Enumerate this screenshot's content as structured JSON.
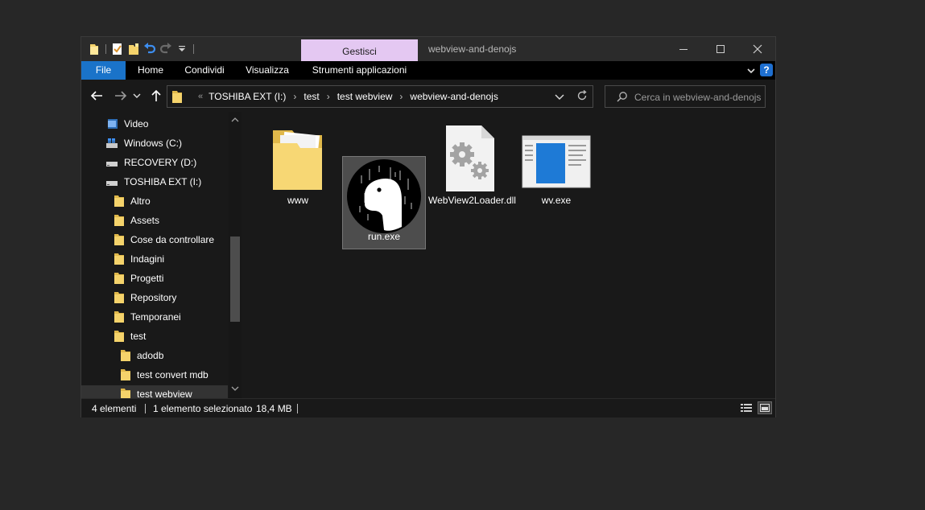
{
  "window": {
    "title": "webview-and-denojs",
    "context_tab": "Gestisci",
    "controls": {
      "minimize_icon": "minimize-icon",
      "maximize_icon": "maximize-icon",
      "close_icon": "close-icon"
    },
    "quick_access": [
      "folder-icon",
      "properties-icon",
      "new-folder-icon",
      "undo-icon",
      "redo-icon",
      "customize-dropdown-icon"
    ]
  },
  "ribbon": {
    "tabs": [
      "File",
      "Home",
      "Condividi",
      "Visualizza",
      "Strumenti applicazioni"
    ],
    "help_label": "?"
  },
  "address": {
    "overflow": "«",
    "breadcrumbs": [
      "TOSHIBA EXT (I:)",
      "test",
      "test webview",
      "webview-and-denojs"
    ]
  },
  "search": {
    "placeholder": "Cerca in webview-and-denojs"
  },
  "nav_tree": [
    {
      "label": "Video",
      "icon": "video-library-icon"
    },
    {
      "label": "Windows (C:)",
      "icon": "windows-drive-icon"
    },
    {
      "label": "RECOVERY (D:)",
      "icon": "drive-icon"
    },
    {
      "label": "TOSHIBA EXT (I:)",
      "icon": "drive-icon"
    },
    {
      "label": "Altro",
      "icon": "folder-icon"
    },
    {
      "label": "Assets",
      "icon": "folder-icon"
    },
    {
      "label": "Cose da controllare",
      "icon": "folder-icon"
    },
    {
      "label": "Indagini",
      "icon": "folder-icon"
    },
    {
      "label": "Progetti",
      "icon": "folder-icon"
    },
    {
      "label": "Repository",
      "icon": "folder-icon"
    },
    {
      "label": "Temporanei",
      "icon": "folder-icon"
    },
    {
      "label": "test",
      "icon": "folder-icon"
    },
    {
      "label": "adodb",
      "icon": "folder-icon"
    },
    {
      "label": "test convert mdb",
      "icon": "folder-icon"
    },
    {
      "label": "test webview",
      "icon": "folder-icon",
      "selected": true
    }
  ],
  "files": [
    {
      "name": "www",
      "icon": "folder-icon"
    },
    {
      "name": "run.exe",
      "icon": "deno-icon",
      "selected": true
    },
    {
      "name": "WebView2Loader.dll",
      "icon": "dll-gears-icon"
    },
    {
      "name": "wv.exe",
      "icon": "app-window-icon"
    }
  ],
  "status": {
    "count": "4 elementi",
    "selection": "1 elemento selezionato",
    "size": "18,4 MB"
  },
  "colors": {
    "accent": "#1a73c9",
    "context_tab": "#e4c8f2",
    "background": "#191919",
    "folder": "#f5d36b"
  }
}
